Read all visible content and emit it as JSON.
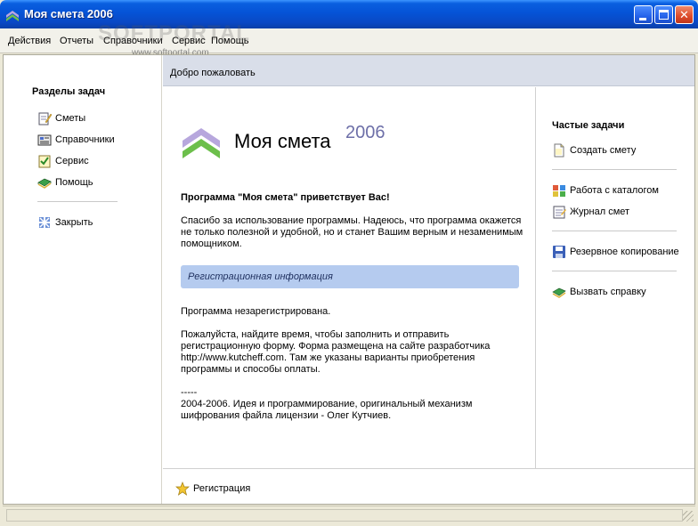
{
  "window": {
    "title": "Моя смета 2006"
  },
  "menu": [
    "Действия",
    "Отчеты",
    "Справочники",
    "Сервис",
    "Помощь"
  ],
  "watermark": {
    "brand": "SOFTPORTAL",
    "url": "www.softportal.com"
  },
  "sidebar": {
    "heading": "Разделы задач",
    "items": [
      {
        "label": "Сметы",
        "icon": "notepad-pencil-icon"
      },
      {
        "label": "Справочники",
        "icon": "catalog-icon"
      },
      {
        "label": "Сервис",
        "icon": "checklist-icon"
      },
      {
        "label": "Помощь",
        "icon": "help-book-icon"
      }
    ],
    "close_label": "Закрыть"
  },
  "welcome": "Добро пожаловать",
  "logo": {
    "name": "Моя смета",
    "year": "2006"
  },
  "main": {
    "greeting": "Программа \"Моя смета\" приветствует Вас!",
    "intro": "Спасибо за использование программы. Надеюсь, что программа окажется не только полезной и удобной, но и станет Вашим верным и незаменимым помощником.",
    "reg_header": "Регистрационная информация",
    "status": "Программа незарегистрирована.",
    "instructions": "Пожалуйста, найдите время, чтобы заполнить и отправить регистрационную форму. Форма размещена на сайте разработчика http://www.kutcheff.com. Там же указаны варианты приобретения программы и способы оплаты.",
    "dashes": "-----",
    "credits": "2004-2006. Идея и программирование, оригинальный механизм шифрования файла лицензии - Олег Кутчиев."
  },
  "tasks": {
    "heading": "Частые задачи",
    "create": "Создать смету",
    "catalog": "Работа с каталогом",
    "journal": "Журнал смет",
    "backup": "Резервное копирование",
    "help": "Вызвать справку"
  },
  "bottom": {
    "register": "Регистрация"
  }
}
